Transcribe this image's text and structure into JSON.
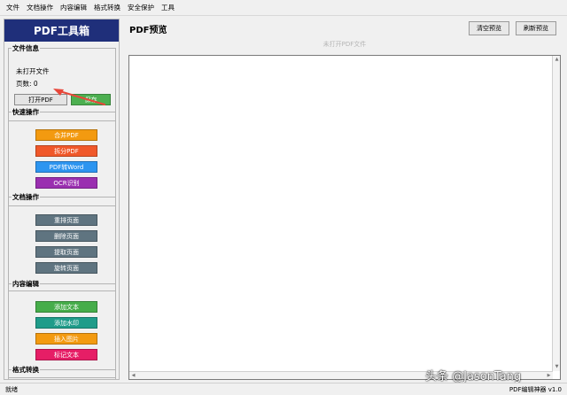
{
  "menu": [
    "文件",
    "文档操作",
    "内容编辑",
    "格式转换",
    "安全保护",
    "工具"
  ],
  "sidebar": {
    "title": "PDF工具箱",
    "file_info": {
      "legend": "文件信息",
      "status": "未打开文件",
      "page_count": "页数: 0",
      "open_label": "打开PDF",
      "save_label": "保存"
    },
    "quick": {
      "legend": "快速操作",
      "buttons": [
        {
          "label": "合并PDF",
          "color": "#f39a10"
        },
        {
          "label": "拆分PDF",
          "color": "#f0582a"
        },
        {
          "label": "PDF转Word",
          "color": "#2d95f0"
        },
        {
          "label": "OCR识别",
          "color": "#9a2fb0"
        }
      ]
    },
    "doc": {
      "legend": "文档操作",
      "buttons": [
        {
          "label": "重排页面",
          "color": "#5f7480"
        },
        {
          "label": "删除页面",
          "color": "#5f7480"
        },
        {
          "label": "提取页面",
          "color": "#5f7480"
        },
        {
          "label": "旋转页面",
          "color": "#5f7480"
        }
      ]
    },
    "content": {
      "legend": "内容编辑",
      "buttons": [
        {
          "label": "添加文本",
          "color": "#46ad4a"
        },
        {
          "label": "添加水印",
          "color": "#1f9c8a"
        },
        {
          "label": "插入图片",
          "color": "#f39a10"
        },
        {
          "label": "标记文本",
          "color": "#e61e66"
        }
      ]
    },
    "convert": {
      "legend": "格式转换"
    },
    "save_button_color": "#4caf50"
  },
  "preview": {
    "title": "PDF预览",
    "clear_label": "清空预览",
    "refresh_label": "刷新预览",
    "hint": "未打开PDF文件"
  },
  "statusbar": {
    "left": "就绪",
    "right": "PDF编辑神器 v1.0"
  },
  "watermark": "头条 @JasonTang",
  "colors": {
    "header_bg": "#1f2f7a",
    "annotation_arrow": "#e8473a"
  }
}
